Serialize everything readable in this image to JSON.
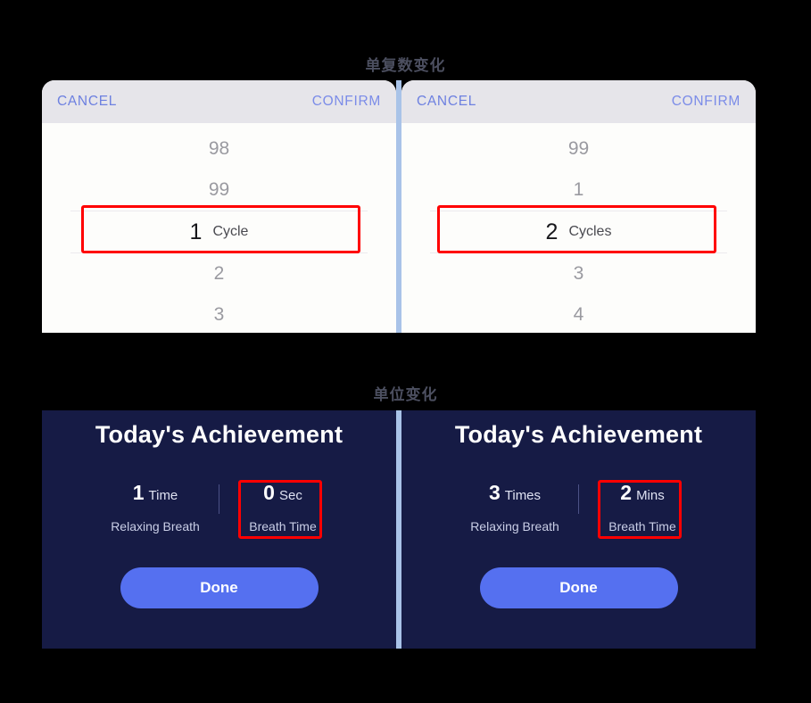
{
  "captions": {
    "top": "单复数变化",
    "bottom": "单位变化"
  },
  "colors": {
    "page_background": "#000000",
    "picker_header": "#e6e5ea",
    "picker_body": "#fdfdfb",
    "accent_blue": "#7b8ce8",
    "divider_blue": "#a9c3e8",
    "annotation_red": "#ff0000",
    "card_navy": "#161b45",
    "done_button": "#5570f0"
  },
  "pickers": [
    {
      "id": "picker-singular",
      "header": {
        "cancel_label": "CANCEL",
        "confirm_label": "CONFIRM"
      },
      "items_above": [
        "98",
        "99"
      ],
      "selected": {
        "value": "1",
        "unit": "Cycle"
      },
      "items_below": [
        "2",
        "3"
      ]
    },
    {
      "id": "picker-plural",
      "header": {
        "cancel_label": "CANCEL",
        "confirm_label": "CONFIRM"
      },
      "items_above": [
        "99",
        "1"
      ],
      "selected": {
        "value": "2",
        "unit": "Cycles"
      },
      "items_below": [
        "3",
        "4"
      ]
    }
  ],
  "achievements": [
    {
      "id": "achievement-seconds",
      "title": "Today's Achievement",
      "stats": [
        {
          "value": "1",
          "unit": "Time",
          "caption": "Relaxing Breath"
        },
        {
          "value": "0",
          "unit": "Sec",
          "caption": "Breath Time"
        }
      ],
      "done_label": "Done"
    },
    {
      "id": "achievement-minutes",
      "title": "Today's Achievement",
      "stats": [
        {
          "value": "3",
          "unit": "Times",
          "caption": "Relaxing Breath"
        },
        {
          "value": "2",
          "unit": "Mins",
          "caption": "Breath Time"
        }
      ],
      "done_label": "Done"
    }
  ]
}
